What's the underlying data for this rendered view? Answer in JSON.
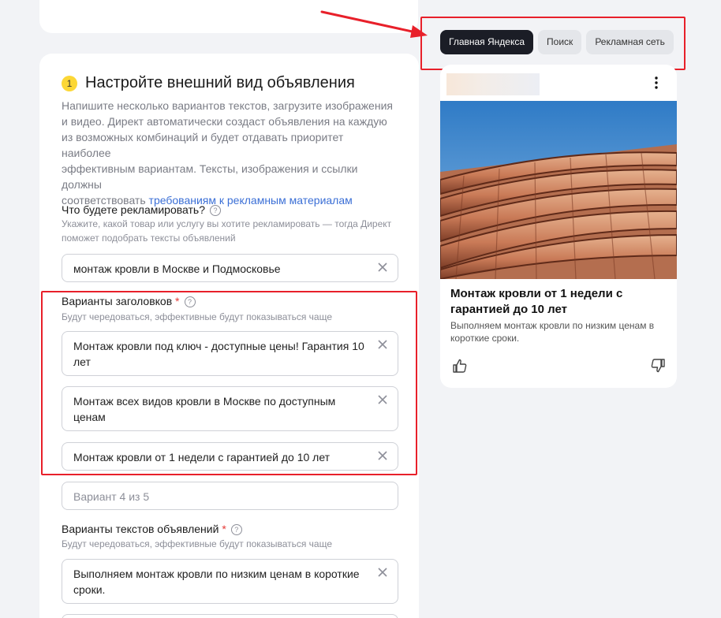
{
  "step": {
    "number": "1",
    "title": "Настройте внешний вид объявления",
    "description_lines": [
      "Напишите несколько вариантов текстов, загрузите изображения",
      "и видео. Директ автоматически создаст объявления на каждую",
      "из возможных комбинаций и будет отдавать приоритет наиболее",
      "эффективным вариантам. Тексты, изображения и ссылки должны"
    ],
    "description_tail": "соответствовать",
    "requirements_link": "требованиям к рекламным материалам"
  },
  "product_field": {
    "label": "Что будете рекламировать?",
    "help": "?",
    "hint": "Укажите, какой товар или услугу вы хотите рекламировать — тогда Директ поможет подобрать тексты объявлений",
    "value": "монтаж кровли в Москве и Подмосковье"
  },
  "headlines": {
    "label": "Варианты заголовков",
    "required_mark": "*",
    "help": "?",
    "hint": "Будут чередоваться, эффективные будут показываться чаще",
    "items": [
      "Монтаж кровли под ключ - доступные цены! Гарантия 10 лет",
      "Монтаж всех видов кровли в Москве по доступным ценам",
      "Монтаж кровли от 1 недели с гарантией до 10 лет"
    ],
    "new_placeholder": "Вариант 4 из 5"
  },
  "ad_texts": {
    "label": "Варианты текстов объявлений",
    "required_mark": "*",
    "help": "?",
    "hint": "Будут чередоваться, эффективные будут показываться чаще",
    "items": [
      "Выполняем монтаж кровли по низким ценам в короткие сроки."
    ]
  },
  "preview_tabs": [
    {
      "label": "Главная Яндекса",
      "active": true
    },
    {
      "label": "Поиск",
      "active": false
    },
    {
      "label": "Рекламная сеть",
      "active": false
    }
  ],
  "preview": {
    "title": "Монтаж кровли от 1 недели с гарантией до 10 лет",
    "text": "Выполняем монтаж кровли по низким ценам в короткие сроки.",
    "image": "roof-tiles-photo"
  },
  "icons": {
    "clear": "close-icon",
    "menu": "more-vertical-icon",
    "like": "thumbs-up-icon",
    "dislike": "thumbs-down-icon"
  },
  "colors": {
    "annotation_red": "#e8202a",
    "link_blue": "#3b6fd6",
    "step_badge": "#fcd736",
    "active_tab": "#1b1d26"
  }
}
